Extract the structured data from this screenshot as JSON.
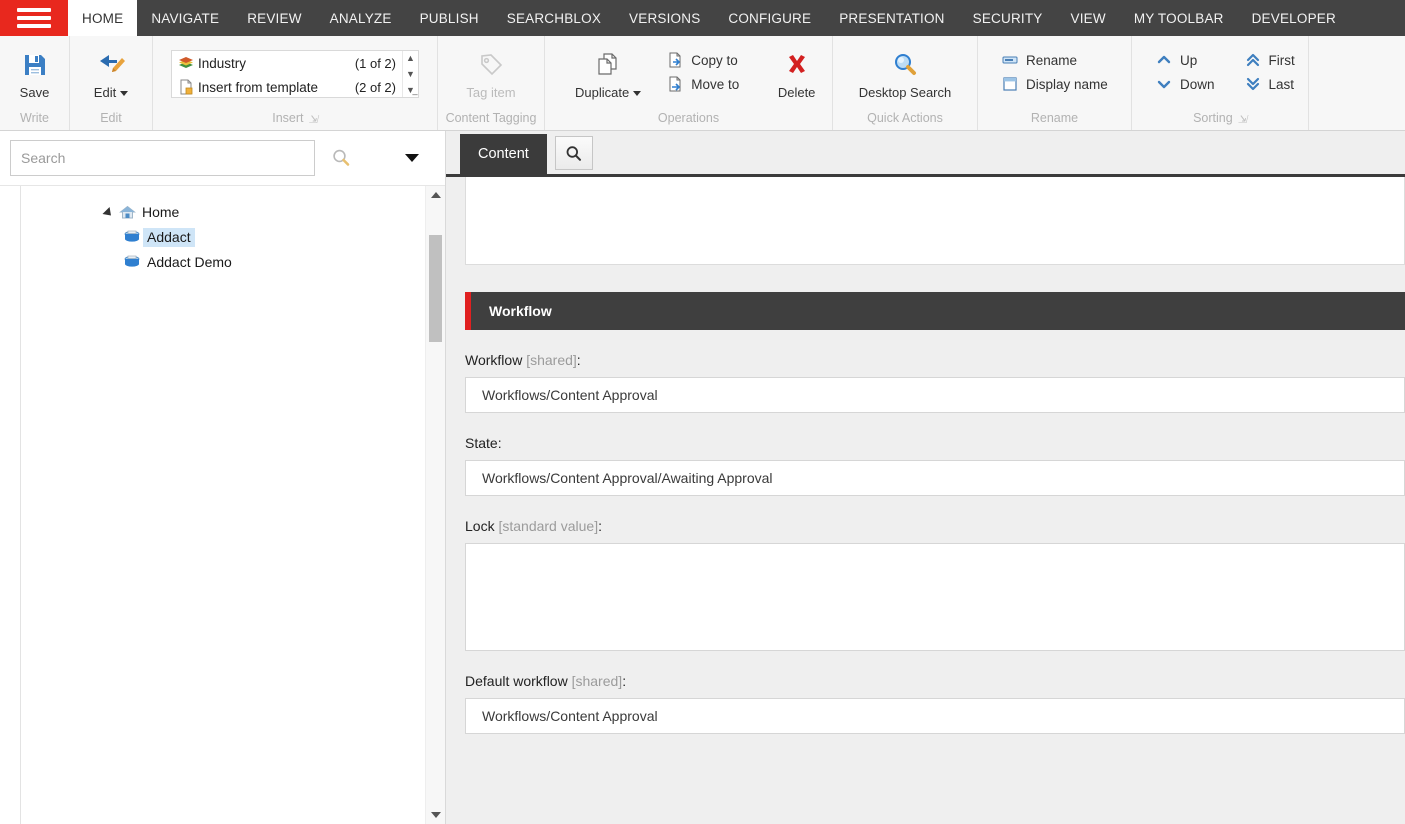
{
  "topnav": {
    "menu_icon": "hamburger-icon",
    "tabs": [
      {
        "label": "HOME",
        "active": true
      },
      {
        "label": "NAVIGATE",
        "active": false
      },
      {
        "label": "REVIEW",
        "active": false
      },
      {
        "label": "ANALYZE",
        "active": false
      },
      {
        "label": "PUBLISH",
        "active": false
      },
      {
        "label": "SEARCHBLOX",
        "active": false
      },
      {
        "label": "VERSIONS",
        "active": false
      },
      {
        "label": "CONFIGURE",
        "active": false
      },
      {
        "label": "PRESENTATION",
        "active": false
      },
      {
        "label": "SECURITY",
        "active": false
      },
      {
        "label": "VIEW",
        "active": false
      },
      {
        "label": "MY TOOLBAR",
        "active": false
      },
      {
        "label": "DEVELOPER",
        "active": false
      }
    ]
  },
  "ribbon": {
    "groups": [
      {
        "name": "write",
        "label": "Write",
        "buttons": [
          {
            "label": "Save",
            "icon": "save-icon"
          }
        ]
      },
      {
        "name": "edit",
        "label": "Edit",
        "buttons": [
          {
            "label": "Edit",
            "icon": "edit-icon",
            "has_caret": true
          }
        ]
      },
      {
        "name": "insert",
        "label": "Insert",
        "has_launcher": true,
        "gallery": [
          {
            "label": "Industry",
            "count": "(1 of 2)",
            "icon": "books-icon"
          },
          {
            "label": "Insert from template",
            "count": "(2 of 2)",
            "icon": "template-icon"
          }
        ]
      },
      {
        "name": "content-tagging",
        "label": "Content Tagging",
        "buttons": [
          {
            "label": "Tag item",
            "icon": "tag-icon",
            "disabled": true
          }
        ]
      },
      {
        "name": "operations",
        "label": "Operations",
        "buttons": [
          {
            "label": "Duplicate",
            "icon": "duplicate-icon",
            "has_caret": true
          },
          {
            "label": "Delete",
            "icon": "delete-icon"
          }
        ],
        "small": [
          {
            "label": "Copy to",
            "icon": "copy-to-icon"
          },
          {
            "label": "Move to",
            "icon": "move-to-icon"
          }
        ]
      },
      {
        "name": "quick-actions",
        "label": "Quick Actions",
        "buttons": [
          {
            "label": "Desktop Search",
            "icon": "magnifier-icon"
          }
        ]
      },
      {
        "name": "rename",
        "label": "Rename",
        "small": [
          {
            "label": "Rename",
            "icon": "rename-icon"
          },
          {
            "label": "Display name",
            "icon": "display-name-icon"
          }
        ]
      },
      {
        "name": "sorting",
        "label": "Sorting",
        "has_launcher": true,
        "small": [
          {
            "label": "Up",
            "icon": "chevron-up-icon"
          },
          {
            "label": "Down",
            "icon": "chevron-down-icon"
          },
          {
            "label": "First",
            "icon": "double-chevron-up-icon"
          },
          {
            "label": "Last",
            "icon": "double-chevron-down-icon"
          }
        ]
      }
    ]
  },
  "sidebar": {
    "search": {
      "value": "",
      "placeholder": "Search",
      "icon": "search-icon",
      "caret_icon": "caret-down-icon"
    },
    "tree": [
      {
        "label": "Home",
        "level": 0,
        "icon": "home-icon",
        "expanded": true,
        "selected": false
      },
      {
        "label": "Addact",
        "level": 1,
        "icon": "bucket-icon",
        "expanded": false,
        "selected": true
      },
      {
        "label": "Addact Demo",
        "level": 1,
        "icon": "bucket-icon",
        "expanded": false,
        "selected": false
      }
    ]
  },
  "content": {
    "tabs": [
      {
        "label": "Content",
        "active": true
      }
    ],
    "search_button_icon": "search-icon",
    "section": {
      "title": "Workflow",
      "accent_color": "#e02020",
      "fields": [
        {
          "name": "workflow",
          "label": "Workflow",
          "meta": "[shared]",
          "value": "Workflows/Content Approval",
          "multiline": false
        },
        {
          "name": "state",
          "label": "State",
          "meta": "",
          "value": "Workflows/Content Approval/Awaiting Approval",
          "multiline": false
        },
        {
          "name": "lock",
          "label": "Lock",
          "meta": "[standard value]",
          "value": "",
          "multiline": true
        },
        {
          "name": "default-workflow",
          "label": "Default workflow",
          "meta": "[shared]",
          "value": "Workflows/Content Approval",
          "multiline": false
        }
      ]
    }
  },
  "colors": {
    "brand_red": "#e8281e",
    "nav_dark": "#444444",
    "section_dark": "#3f3f3f",
    "panel_bg": "#efefef"
  }
}
